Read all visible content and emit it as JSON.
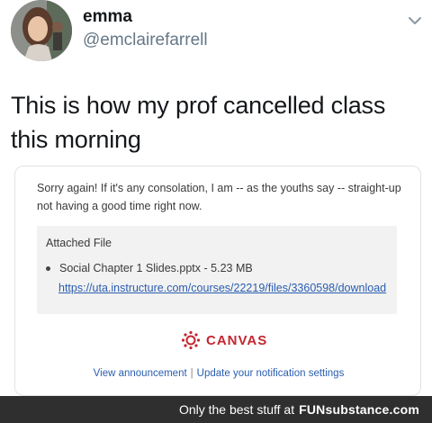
{
  "tweet": {
    "author_name": "emma",
    "author_handle": "@emclairefarrell",
    "text": "This is how my prof cancelled class this morning"
  },
  "email": {
    "message": "Sorry again! If it's any consolation, I am -- as the youths say -- straight-up not having a good time right now.",
    "attachment_title": "Attached File",
    "attachment_name": "Social Chapter 1 Slides.pptx - 5.23 MB",
    "attachment_link": "https://uta.instructure.com/courses/22219/files/3360598/download",
    "brand": "CANVAS",
    "footer_view": "View announcement",
    "footer_separator": "|",
    "footer_update": "Update your notification settings"
  },
  "banner": {
    "prefix": "Only the best stuff at",
    "brand": "FUNsubstance.com"
  },
  "colors": {
    "canvas_red": "#c5252f",
    "link_blue": "#2a5db0",
    "banner_bg": "#2f2f2f"
  },
  "icons": [
    "avatar-photo",
    "chevron-down-icon",
    "canvas-logo-icon",
    "bullet-icon"
  ]
}
